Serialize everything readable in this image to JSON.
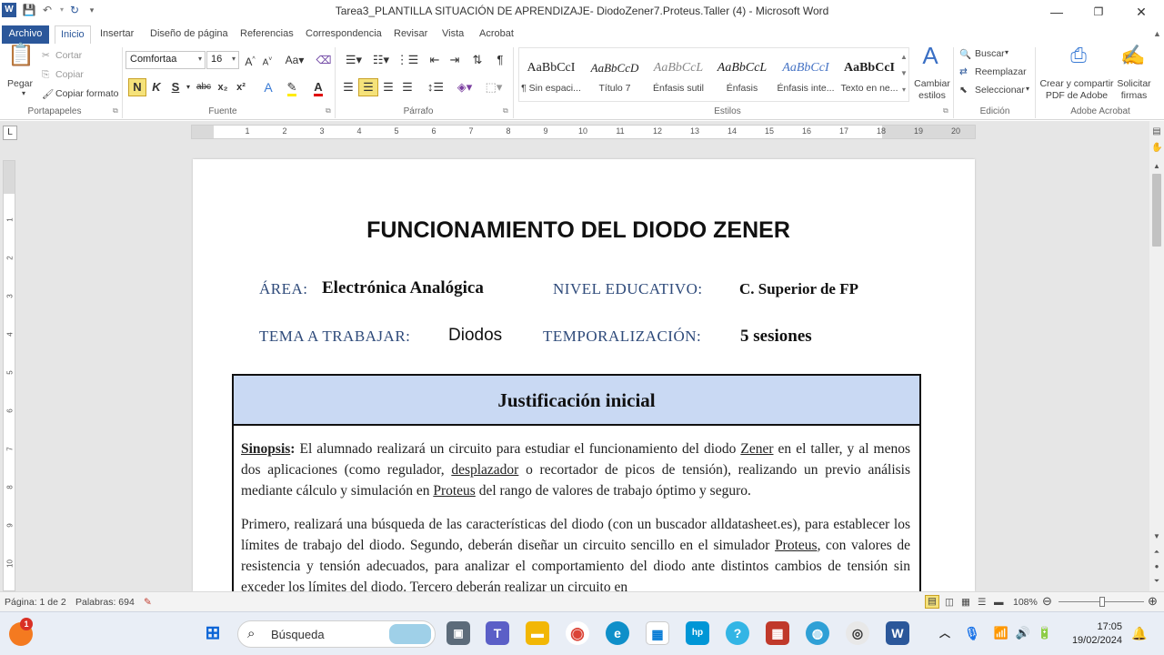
{
  "window": {
    "title": "Tarea3_PLANTILLA SITUACIÓN DE APRENDIZAJE- DiodoZener7.Proteus.Taller (4)  -  Microsoft Word",
    "minimize": "—",
    "restore": "❐",
    "close": "✕"
  },
  "tabs": [
    "Archivo",
    "Inicio",
    "Insertar",
    "Diseño de página",
    "Referencias",
    "Correspondencia",
    "Revisar",
    "Vista",
    "Acrobat"
  ],
  "ribbon": {
    "clipboard": {
      "paste": "Pegar",
      "cut": "Cortar",
      "copy": "Copiar",
      "format_painter": "Copiar formato",
      "label": "Portapapeles"
    },
    "font": {
      "family": "Comfortaa",
      "size": "16",
      "label": "Fuente",
      "bold": "N",
      "italic": "K",
      "underline": "S",
      "strike": "abc",
      "sub": "x₂",
      "sup": "x²"
    },
    "paragraph": {
      "label": "Párrafo"
    },
    "styles": {
      "label": "Estilos",
      "items": [
        {
          "sample": "AaBbCcI",
          "name": "¶ Sin espaci..."
        },
        {
          "sample": "AaBbCcD",
          "name": "Título 7"
        },
        {
          "sample": "AaBbCcL",
          "name": "Énfasis sutil"
        },
        {
          "sample": "AaBbCcL",
          "name": "Énfasis"
        },
        {
          "sample": "AaBbCcI",
          "name": "Énfasis inte..."
        },
        {
          "sample": "AaBbCcI",
          "name": "Texto en ne..."
        }
      ],
      "change": "Cambiar estilos"
    },
    "editing": {
      "label": "Edición",
      "find": "Buscar",
      "replace": "Reemplazar",
      "select": "Seleccionar"
    },
    "acrobat": {
      "label": "Adobe Acrobat",
      "create_share": "Crear y compartir PDF de Adobe",
      "request_sign": "Solicitar firmas"
    }
  },
  "ruler": {
    "h_numbers": [
      "1",
      "2",
      "3",
      "4",
      "5",
      "6",
      "7",
      "8",
      "9",
      "10",
      "11",
      "12",
      "13",
      "14",
      "15",
      "16",
      "17",
      "18",
      "19",
      "20"
    ],
    "v_numbers": [
      "1",
      "2",
      "3",
      "4",
      "5",
      "6",
      "7",
      "8",
      "9",
      "10"
    ],
    "tab_selector": "L"
  },
  "document": {
    "title": "FUNCIONAMIENTO DEL DIODO ZENER",
    "area_key": "ÁREA:",
    "area_value": "Electrónica Analógica",
    "level_key": "NIVEL EDUCATIVO:",
    "level_value": "C. Superior de FP",
    "topic_key": "TEMA A TRABAJAR:",
    "topic_value": "Diodos",
    "time_key": "TEMPORALIZACIÓN:",
    "time_value": "5 sesiones",
    "table_header": "Justificación inicial",
    "synopsis_label": "Sinopsis",
    "synopsis_text_1": "El alumnado realizará un circuito para estudiar el funcionamiento del diodo",
    "synopsis_zener": "Zener",
    "synopsis_text_2": "en el taller, y al menos dos aplicaciones (como regulador,",
    "synopsis_desplazador": "desplazador",
    "synopsis_text_3": "o recortador de picos de tensión), realizando un previo análisis mediante cálculo y simulación en",
    "synopsis_proteus": "Proteus",
    "synopsis_text_4": "del rango de valores de trabajo óptimo y seguro.",
    "para2_text_1": "Primero, realizará una búsqueda de las características del diodo (con un buscador alldatasheet.es), para establecer los límites de trabajo del diodo. Segundo, deberán diseñar un circuito sencillo en el simulador",
    "para2_proteus": "Proteus",
    "para2_text_2": ", con valores de resistencia y tensión adecuados, para analizar el comportamiento del diodo ante distintos cambios de tensión sin exceder los límites del diodo. Tercero deberán realizar un circuito en"
  },
  "statusbar": {
    "page": "Página: 1 de 2",
    "words": "Palabras: 694",
    "zoom": "108%",
    "zoom_level_percent": 108
  },
  "taskbar": {
    "search_placeholder": "Búsqueda",
    "time": "17:05",
    "date": "19/02/2024",
    "notification_badge": "1"
  }
}
